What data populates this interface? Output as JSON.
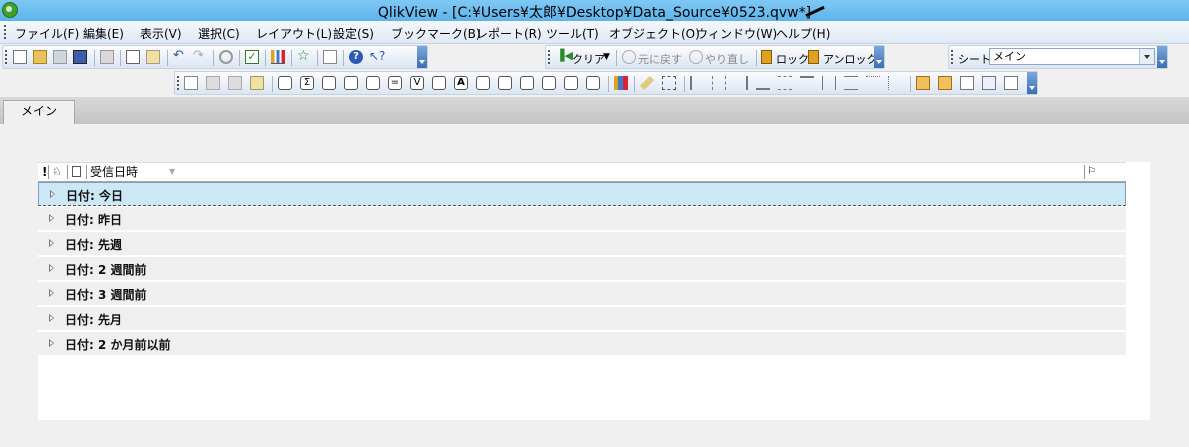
{
  "window": {
    "title": "QlikView - [C:¥Users¥太郎¥Desktop¥Data_Source¥0523.qvw*]"
  },
  "menu": [
    {
      "label": "ファイル(F)"
    },
    {
      "label": "編集(E)"
    },
    {
      "label": "表示(V)"
    },
    {
      "label": "選択(C)"
    },
    {
      "label": "レイアウト(L)"
    },
    {
      "label": "設定(S)"
    },
    {
      "label": "ブックマーク(B)"
    },
    {
      "label": "レポート(R)"
    },
    {
      "label": "ツール(T)"
    },
    {
      "label": "オブジェクト(O)"
    },
    {
      "label": "ウィンドウ(W)"
    },
    {
      "label": "ヘルプ(H)"
    }
  ],
  "nav_toolbar": {
    "clear": "クリア",
    "undo": "元に戻す",
    "redo": "やり直し",
    "lock": "ロック",
    "unlock": "アンロック"
  },
  "sheet_selector": {
    "label": "シート",
    "value": "メイン"
  },
  "tabs": [
    {
      "label": "メイン"
    }
  ],
  "listbox": {
    "header": {
      "column": "受信日時"
    },
    "rows": [
      {
        "label": "日付: 今日"
      },
      {
        "label": "日付: 昨日"
      },
      {
        "label": "日付: 先週"
      },
      {
        "label": "日付: 2 週間前"
      },
      {
        "label": "日付: 3 週間前"
      },
      {
        "label": "日付: 先月"
      },
      {
        "label": "日付: 2 か月前以前"
      }
    ]
  }
}
